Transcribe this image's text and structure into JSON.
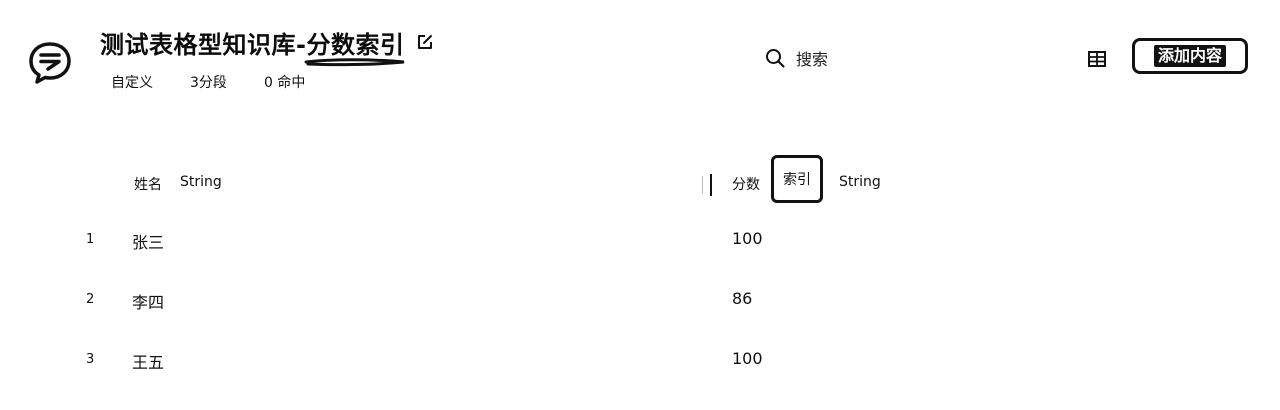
{
  "header": {
    "title": "测试表格型知识库-分数索引",
    "meta": [
      "自定义",
      "3分段",
      "0 命中"
    ],
    "search_label": "搜索",
    "add_button": "添加内容"
  },
  "table": {
    "columns": [
      {
        "name": "姓名",
        "type": "String"
      },
      {
        "name": "分数",
        "badge": "索引",
        "type": "String"
      }
    ],
    "rows": [
      {
        "index": "1",
        "name": "张三",
        "score": "100"
      },
      {
        "index": "2",
        "name": "李四",
        "score": "86"
      },
      {
        "index": "3",
        "name": "王五",
        "score": "100"
      }
    ]
  },
  "icons": {
    "logo": "chat-bubble-logo-icon",
    "edit": "edit-icon",
    "search": "search-icon",
    "grid": "table-view-icon"
  }
}
